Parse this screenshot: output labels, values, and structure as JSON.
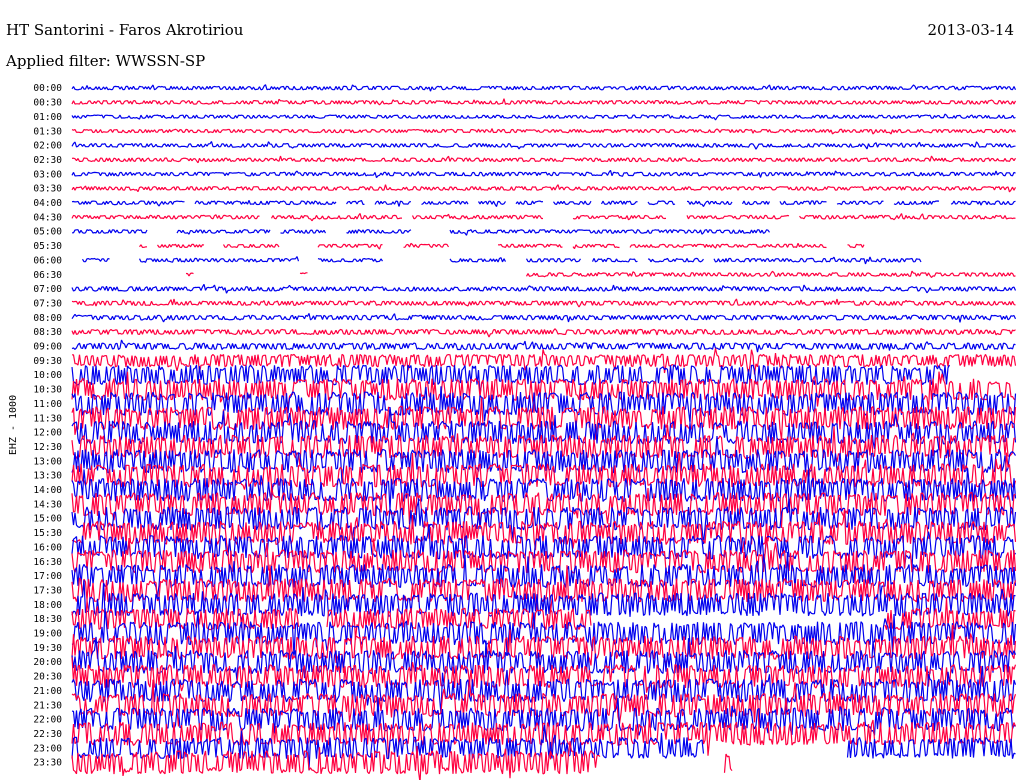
{
  "header": {
    "station": "HT Santorini - Faros Akrotiriou",
    "date": "2013-03-14",
    "filter": "Applied filter: WWSSN-SP"
  },
  "chart_data": {
    "type": "helicorder",
    "channel_label": "EHZ - 1000",
    "colors": [
      "#0000ee",
      "#ff0040"
    ],
    "rows": [
      {
        "label": "00:00",
        "amplitude": 1.0,
        "gaps": []
      },
      {
        "label": "00:30",
        "amplitude": 1.0,
        "gaps": []
      },
      {
        "label": "01:00",
        "amplitude": 0.9,
        "gaps": []
      },
      {
        "label": "01:30",
        "amplitude": 0.9,
        "gaps": []
      },
      {
        "label": "02:00",
        "amplitude": 1.0,
        "gaps": []
      },
      {
        "label": "02:30",
        "amplitude": 1.0,
        "gaps": []
      },
      {
        "label": "03:00",
        "amplitude": 1.0,
        "gaps": []
      },
      {
        "label": "03:30",
        "amplitude": 1.0,
        "gaps": []
      },
      {
        "label": "04:00",
        "amplitude": 1.0,
        "gaps": [
          [
            0.12,
            0.13
          ],
          [
            0.28,
            0.29
          ],
          [
            0.31,
            0.32
          ],
          [
            0.36,
            0.37
          ],
          [
            0.42,
            0.43
          ],
          [
            0.46,
            0.47
          ],
          [
            0.5,
            0.51
          ],
          [
            0.55,
            0.56
          ],
          [
            0.6,
            0.61
          ],
          [
            0.64,
            0.65
          ],
          [
            0.7,
            0.71
          ],
          [
            0.74,
            0.75
          ],
          [
            0.8,
            0.81
          ],
          [
            0.86,
            0.87
          ],
          [
            0.92,
            0.93
          ]
        ]
      },
      {
        "label": "04:30",
        "amplitude": 1.0,
        "gaps": [
          [
            0.2,
            0.21
          ],
          [
            0.35,
            0.36
          ],
          [
            0.5,
            0.53
          ],
          [
            0.63,
            0.65
          ],
          [
            0.76,
            0.77
          ]
        ]
      },
      {
        "label": "05:00",
        "amplitude": 1.0,
        "gaps": [
          [
            0.08,
            0.11
          ],
          [
            0.21,
            0.22
          ],
          [
            0.27,
            0.29
          ],
          [
            0.36,
            0.4
          ],
          [
            0.74,
            1.0
          ]
        ]
      },
      {
        "label": "05:30",
        "amplitude": 0.9,
        "gaps": [
          [
            0.0,
            0.07
          ],
          [
            0.08,
            0.09
          ],
          [
            0.14,
            0.16
          ],
          [
            0.22,
            0.26
          ],
          [
            0.33,
            0.35
          ],
          [
            0.4,
            0.45
          ],
          [
            0.52,
            0.53
          ],
          [
            0.58,
            0.59
          ],
          [
            0.8,
            0.82
          ],
          [
            0.84,
            1.0
          ]
        ]
      },
      {
        "label": "06:00",
        "amplitude": 1.0,
        "gaps": [
          [
            0.0,
            0.01
          ],
          [
            0.04,
            0.07
          ],
          [
            0.24,
            0.26
          ],
          [
            0.33,
            0.4
          ],
          [
            0.46,
            0.48
          ],
          [
            0.54,
            0.55
          ],
          [
            0.6,
            0.61
          ],
          [
            0.67,
            0.68
          ],
          [
            0.9,
            1.0
          ]
        ]
      },
      {
        "label": "06:30",
        "amplitude": 1.0,
        "gaps": [
          [
            0.0,
            0.12
          ],
          [
            0.13,
            0.24
          ],
          [
            0.25,
            0.48
          ]
        ]
      },
      {
        "label": "07:00",
        "amplitude": 1.2,
        "gaps": []
      },
      {
        "label": "07:30",
        "amplitude": 1.2,
        "gaps": []
      },
      {
        "label": "08:00",
        "amplitude": 1.3,
        "gaps": []
      },
      {
        "label": "08:30",
        "amplitude": 1.4,
        "gaps": []
      },
      {
        "label": "09:00",
        "amplitude": 1.8,
        "gaps": []
      },
      {
        "label": "09:30",
        "amplitude": 3.5,
        "gaps": []
      },
      {
        "label": "10:00",
        "amplitude": 5.5,
        "gaps": [
          [
            0.93,
            1.0
          ]
        ]
      },
      {
        "label": "10:30",
        "amplitude": 6.0,
        "gaps": []
      },
      {
        "label": "11:00",
        "amplitude": 6.5,
        "gaps": []
      },
      {
        "label": "11:30",
        "amplitude": 6.5,
        "gaps": []
      },
      {
        "label": "12:00",
        "amplitude": 6.5,
        "gaps": []
      },
      {
        "label": "12:30",
        "amplitude": 6.5,
        "gaps": []
      },
      {
        "label": "13:00",
        "amplitude": 6.5,
        "gaps": []
      },
      {
        "label": "13:30",
        "amplitude": 6.5,
        "gaps": []
      },
      {
        "label": "14:00",
        "amplitude": 6.5,
        "gaps": []
      },
      {
        "label": "14:30",
        "amplitude": 6.5,
        "gaps": []
      },
      {
        "label": "15:00",
        "amplitude": 6.5,
        "gaps": []
      },
      {
        "label": "15:30",
        "amplitude": 6.5,
        "gaps": []
      },
      {
        "label": "16:00",
        "amplitude": 6.5,
        "gaps": []
      },
      {
        "label": "16:30",
        "amplitude": 6.5,
        "gaps": []
      },
      {
        "label": "17:00",
        "amplitude": 6.5,
        "gaps": []
      },
      {
        "label": "17:30",
        "amplitude": 6.5,
        "gaps": []
      },
      {
        "label": "18:00",
        "amplitude": 6.5,
        "gaps": []
      },
      {
        "label": "18:30",
        "amplitude": 6.0,
        "gaps": [
          [
            0.24,
            0.27
          ],
          [
            0.55,
            0.86
          ]
        ]
      },
      {
        "label": "19:00",
        "amplitude": 6.5,
        "gaps": []
      },
      {
        "label": "19:30",
        "amplitude": 6.5,
        "gaps": []
      },
      {
        "label": "20:00",
        "amplitude": 6.5,
        "gaps": []
      },
      {
        "label": "20:30",
        "amplitude": 6.5,
        "gaps": []
      },
      {
        "label": "21:00",
        "amplitude": 6.5,
        "gaps": []
      },
      {
        "label": "21:30",
        "amplitude": 6.5,
        "gaps": []
      },
      {
        "label": "22:00",
        "amplitude": 6.5,
        "gaps": []
      },
      {
        "label": "22:30",
        "amplitude": 6.5,
        "gaps": []
      },
      {
        "label": "23:00",
        "amplitude": 6.0,
        "gaps": [
          [
            0.67,
            0.82
          ]
        ]
      },
      {
        "label": "23:30",
        "amplitude": 6.5,
        "gaps": [
          [
            0.56,
            0.69
          ],
          [
            0.7,
            1.0
          ]
        ]
      }
    ]
  }
}
